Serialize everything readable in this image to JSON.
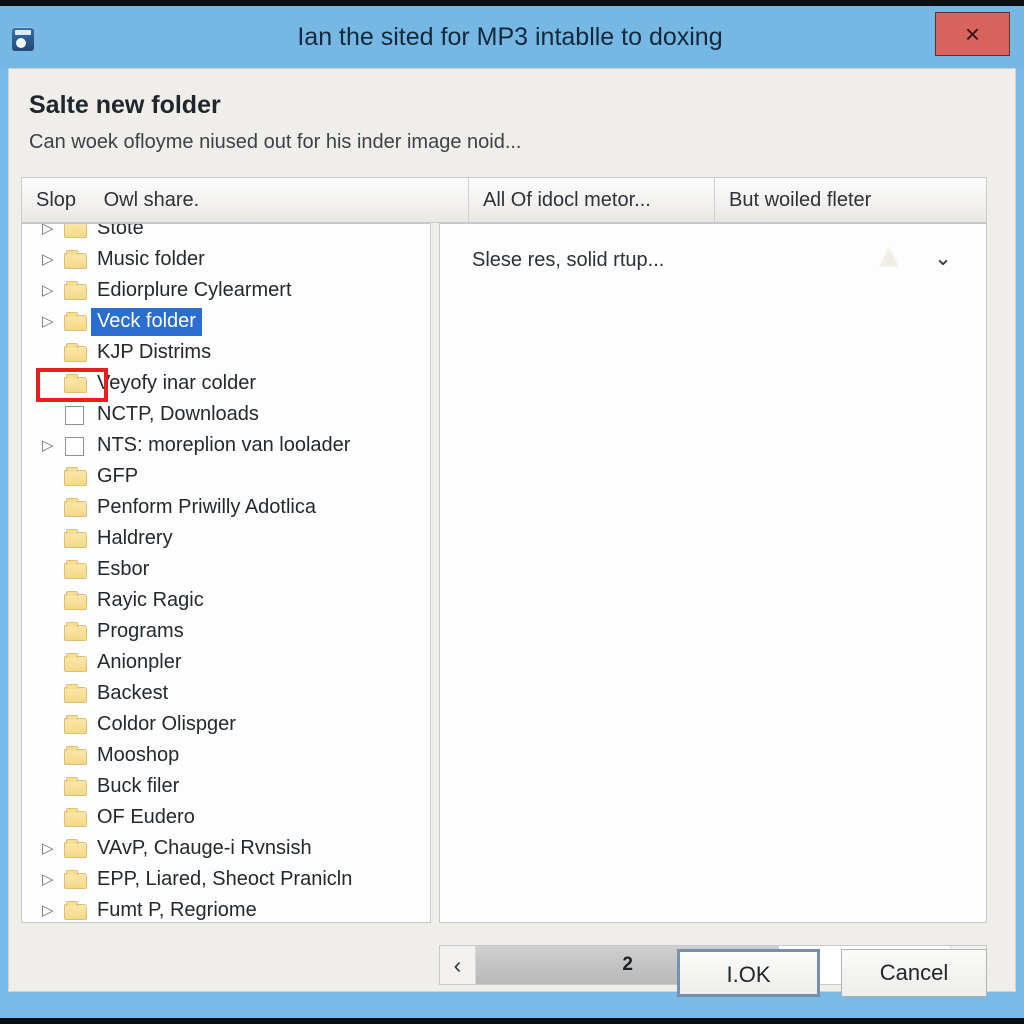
{
  "window": {
    "title": "Ian the sited for MP3 intablle to doxing",
    "app_icon": "disk-icon",
    "close_label": "×",
    "close_icon": "close-icon",
    "titlebar_color": "#74b8e3",
    "close_button_color": "#d9635f"
  },
  "dialog": {
    "heading": "Salte new folder",
    "subheading": "Can woek ofloyme niused out for his inder image noid...",
    "selection_color": "#2a6fd0",
    "annotation_color": "#e81f1f"
  },
  "columns": [
    {
      "label": "Slop",
      "sub_label": "Owl share."
    },
    {
      "label": "All Of idocl metor...",
      "sub_label": ""
    },
    {
      "label": "But woiled fleter",
      "sub_label": ""
    }
  ],
  "tree": {
    "items": [
      {
        "label": "Stote",
        "twisty": true,
        "icon": "folder-icon",
        "selected": false,
        "clipped": true
      },
      {
        "label": "Music folder",
        "twisty": true,
        "icon": "folder-icon",
        "selected": false
      },
      {
        "label": "Ediorplure Cylearmert",
        "twisty": true,
        "icon": "folder-icon",
        "selected": false
      },
      {
        "label": "Veck folder",
        "twisty": true,
        "icon": "folder-icon",
        "selected": true
      },
      {
        "label": "KJP Distrims",
        "twisty": false,
        "icon": "folder-icon",
        "selected": false
      },
      {
        "label": "Veyofy inar colder",
        "twisty": false,
        "icon": "folder-icon",
        "selected": false
      },
      {
        "label": "NCTP, Downloads",
        "twisty": false,
        "icon": "checkbox-unchecked",
        "selected": false
      },
      {
        "label": "NTS: moreplion van loolader",
        "twisty": true,
        "icon": "checkbox-unchecked",
        "selected": false
      },
      {
        "label": "GFP",
        "twisty": false,
        "icon": "folder-icon",
        "selected": false
      },
      {
        "label": "Penform Priwilly Adotlica",
        "twisty": false,
        "icon": "folder-icon",
        "selected": false
      },
      {
        "label": "Haldrery",
        "twisty": false,
        "icon": "folder-icon",
        "selected": false
      },
      {
        "label": "Esbor",
        "twisty": false,
        "icon": "folder-icon",
        "selected": false
      },
      {
        "label": "Rayic Ragic",
        "twisty": false,
        "icon": "folder-icon",
        "selected": false
      },
      {
        "label": "Programs",
        "twisty": false,
        "icon": "folder-icon",
        "selected": false
      },
      {
        "label": "Anionpler",
        "twisty": false,
        "icon": "folder-icon",
        "selected": false
      },
      {
        "label": "Backest",
        "twisty": false,
        "icon": "folder-icon",
        "selected": false
      },
      {
        "label": "Coldor Olispger",
        "twisty": false,
        "icon": "folder-icon",
        "selected": false
      },
      {
        "label": "Mooshop",
        "twisty": false,
        "icon": "folder-icon",
        "selected": false
      },
      {
        "label": "Buck filer",
        "twisty": false,
        "icon": "folder-icon",
        "selected": false
      },
      {
        "label": "OF Eudero",
        "twisty": false,
        "icon": "folder-icon",
        "selected": false
      },
      {
        "label": "VAvP, Chauge-i Rvnsish",
        "twisty": true,
        "icon": "folder-icon",
        "selected": false
      },
      {
        "label": "EPP, Liared, Sheoct Pranicln",
        "twisty": true,
        "icon": "folder-icon",
        "selected": false
      },
      {
        "label": "Fumt P, Regriome",
        "twisty": true,
        "icon": "folder-icon",
        "selected": false
      }
    ]
  },
  "right_panel": {
    "row_label": "Slese res, solid rtup...",
    "row_icon": "tree-shape-icon",
    "chevron": "⌄",
    "chevron_icon": "chevron-down-icon"
  },
  "hscroll": {
    "left_arrow": "‹",
    "right_arrow": "›",
    "thumb_label": "2"
  },
  "footer": {
    "ok_label": "I.OK",
    "cancel_label": "Cancel"
  }
}
